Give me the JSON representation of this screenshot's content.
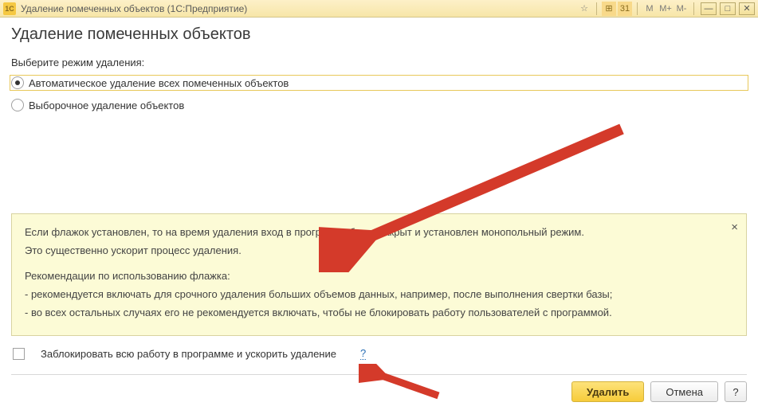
{
  "titlebar": {
    "app_icon_text": "1C",
    "title": "Удаление помеченных объектов  (1С:Предприятие)",
    "tools": {
      "m": "M",
      "mplus": "M+",
      "mminus": "M-"
    }
  },
  "page": {
    "title": "Удаление помеченных объектов",
    "mode_label": "Выберите режим удаления:",
    "radio_auto": "Автоматическое удаление всех помеченных объектов",
    "radio_selective": "Выборочное удаление объектов"
  },
  "info": {
    "line1": "Если флажок установлен, то на время удаления вход в программу будет закрыт и установлен монопольный режим.",
    "line2": "Это существенно ускорит процесс удаления.",
    "recs_title": "Рекомендации по использованию флажка:",
    "rec1": "- рекомендуется включать для срочного удаления больших объемов данных, например, после выполнения свертки базы;",
    "rec2": "- во всех остальных случаях его не рекомендуется включать, чтобы не блокировать работу пользователей с программой.",
    "close": "×"
  },
  "checkbox": {
    "label": "Заблокировать всю работу в программе и ускорить удаление",
    "help": "?"
  },
  "footer": {
    "delete": "Удалить",
    "cancel": "Отмена",
    "help": "?"
  }
}
